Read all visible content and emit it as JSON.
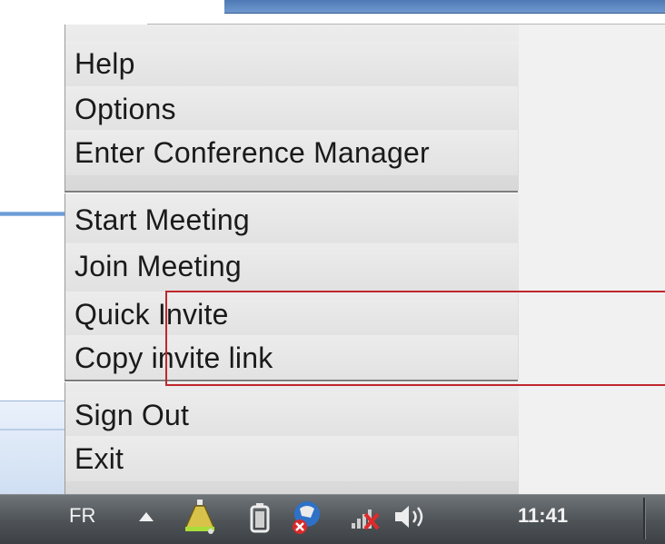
{
  "menu": {
    "groups": [
      [
        "Help",
        "Options",
        "Enter Conference Manager"
      ],
      [
        "Start Meeting",
        "Join Meeting"
      ],
      [
        "Quick Invite",
        "Copy invite link"
      ],
      [
        "Sign Out",
        "Exit"
      ]
    ]
  },
  "taskbar": {
    "language": "FR",
    "clock": "11:41"
  },
  "icons": {
    "tray": [
      "show-hidden-icons-arrow",
      "app-tray-icon",
      "battery-icon",
      "action-center-icon",
      "network-icon",
      "volume-icon"
    ],
    "toolbar": [
      "reading-layout-icon",
      "grid-layout-icon"
    ]
  },
  "colors": {
    "highlight_border": "#c0272d",
    "taskbar": "#4d5256"
  }
}
